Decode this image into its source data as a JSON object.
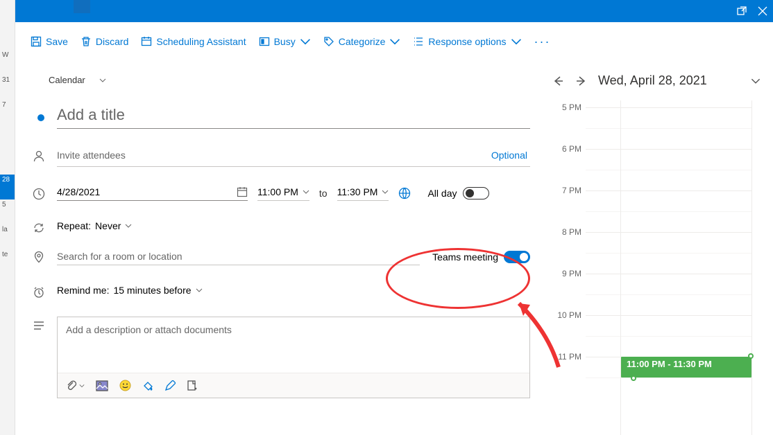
{
  "background_items": [
    "W",
    "31",
    "7",
    "",
    "",
    "28",
    "5",
    "la",
    "te"
  ],
  "toolbar": {
    "save": "Save",
    "discard": "Discard",
    "scheduling": "Scheduling Assistant",
    "busy": "Busy",
    "categorize": "Categorize",
    "response": "Response options",
    "more": "···"
  },
  "calendar_picker": "Calendar",
  "fields": {
    "title_placeholder": "Add a title",
    "attendees_placeholder": "Invite attendees",
    "optional": "Optional",
    "date": "4/28/2021",
    "time_start": "11:00 PM",
    "to": "to",
    "time_end": "11:30 PM",
    "allday": "All day",
    "repeat_label": "Repeat:",
    "repeat_value": "Never",
    "location_placeholder": "Search for a room or location",
    "teams": "Teams meeting",
    "remind_label": "Remind me:",
    "remind_value": "15 minutes before",
    "description_placeholder": "Add a description or attach documents"
  },
  "sidebar": {
    "date_label": "Wed, April 28, 2021",
    "hours": [
      "5 PM",
      "6 PM",
      "7 PM",
      "8 PM",
      "9 PM",
      "10 PM",
      "11 PM"
    ],
    "event_text": "11:00 PM - 11:30 PM"
  }
}
